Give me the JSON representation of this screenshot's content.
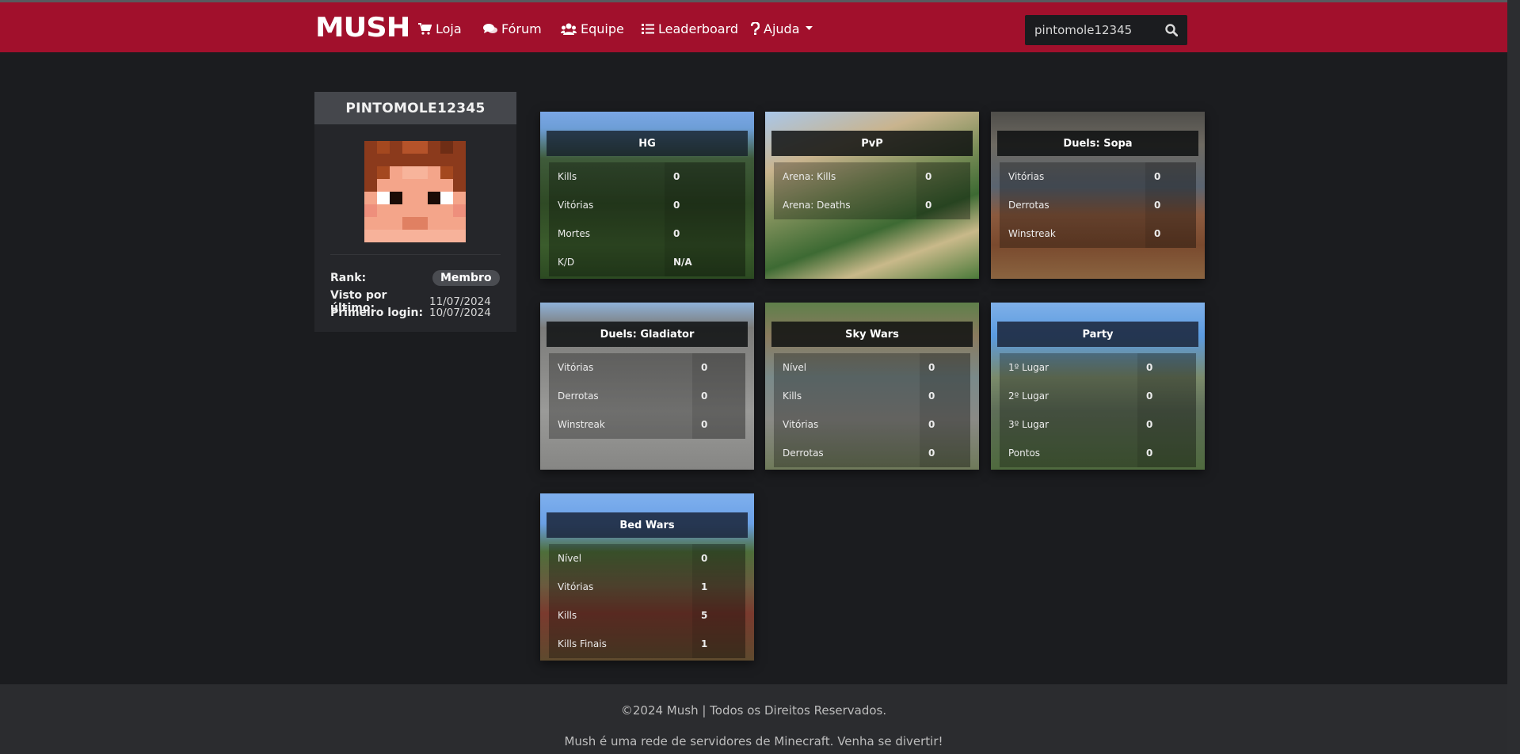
{
  "nav": {
    "logo": "MUSH",
    "items": [
      {
        "label": "Loja",
        "icon": "cart-icon"
      },
      {
        "label": "Fórum",
        "icon": "comments-icon"
      },
      {
        "label": "Equipe",
        "icon": "users-icon"
      },
      {
        "label": "Leaderboard",
        "icon": "list-icon"
      },
      {
        "label": "Ajuda",
        "icon": "question-icon"
      }
    ],
    "search_value": "pintomole12345"
  },
  "profile": {
    "username": "PINTOMOLE12345",
    "rank_label": "Rank:",
    "rank_value": "Membro",
    "last_seen_label": "Visto por último:",
    "last_seen_value": "11/07/2024",
    "first_login_label": "Primeiro login:",
    "first_login_value": "10/07/2024"
  },
  "cards": [
    {
      "title": "HG",
      "rows": [
        [
          "Kills",
          "0"
        ],
        [
          "Vitórias",
          "0"
        ],
        [
          "Mortes",
          "0"
        ],
        [
          "K/D",
          "N/A"
        ]
      ]
    },
    {
      "title": "PvP",
      "rows": [
        [
          "Arena: Kills",
          "0"
        ],
        [
          "Arena: Deaths",
          "0"
        ]
      ]
    },
    {
      "title": "Duels: Sopa",
      "rows": [
        [
          "Vitórias",
          "0"
        ],
        [
          "Derrotas",
          "0"
        ],
        [
          "Winstreak",
          "0"
        ]
      ]
    },
    {
      "title": "Duels: Gladiator",
      "rows": [
        [
          "Vitórias",
          "0"
        ],
        [
          "Derrotas",
          "0"
        ],
        [
          "Winstreak",
          "0"
        ]
      ]
    },
    {
      "title": "Sky Wars",
      "rows": [
        [
          "Nível",
          "0"
        ],
        [
          "Kills",
          "0"
        ],
        [
          "Vitórias",
          "0"
        ],
        [
          "Derrotas",
          "0"
        ]
      ]
    },
    {
      "title": "Party",
      "rows": [
        [
          "1º Lugar",
          "0"
        ],
        [
          "2º Lugar",
          "0"
        ],
        [
          "3º Lugar",
          "0"
        ],
        [
          "Pontos",
          "0"
        ]
      ]
    },
    {
      "title": "Bed Wars",
      "rows": [
        [
          "Nível",
          "0"
        ],
        [
          "Vitórias",
          "1"
        ],
        [
          "Kills",
          "5"
        ],
        [
          "Kills Finais",
          "1"
        ]
      ]
    }
  ],
  "footer": {
    "copyright": "©2024 Mush | Todos os Direitos Reservados.",
    "tagline": "Mush é uma rede de servidores de Minecraft. Venha se divertir!"
  },
  "colors": {
    "brand": "#a1102c",
    "background": "#1b1c1f"
  }
}
